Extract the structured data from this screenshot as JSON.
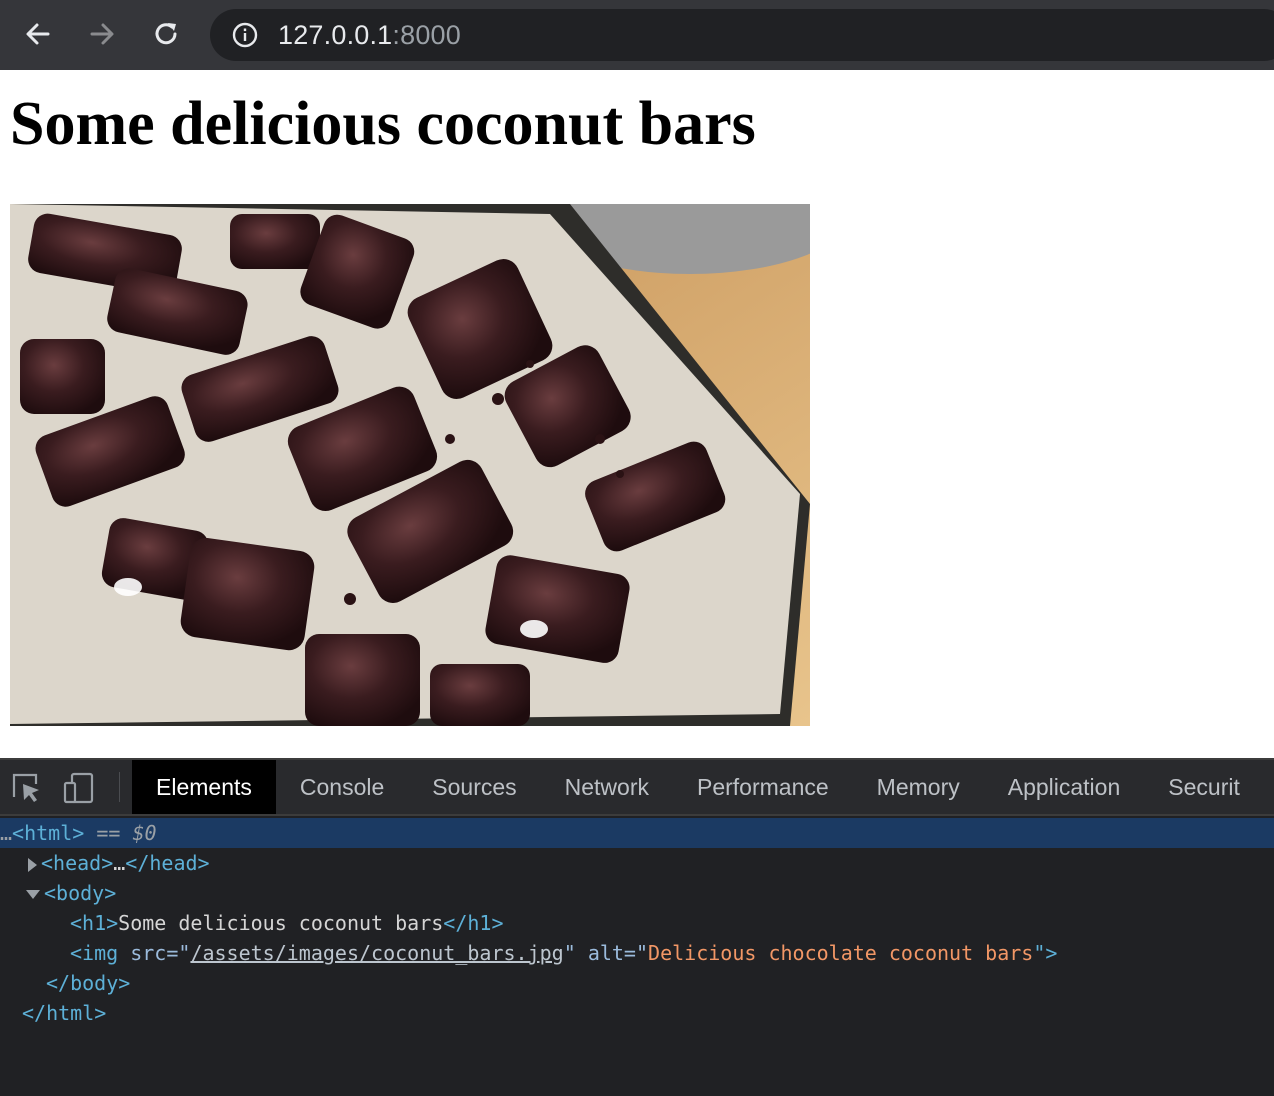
{
  "browser": {
    "url_host": "127.0.0.1",
    "url_port": ":8000",
    "icons": [
      "back-arrow-icon",
      "forward-arrow-icon",
      "reload-icon",
      "info-icon"
    ]
  },
  "page": {
    "title": "Some delicious coconut bars",
    "image_alt": "Delicious chocolate coconut bars"
  },
  "devtools": {
    "tabs": [
      "Elements",
      "Console",
      "Sources",
      "Network",
      "Performance",
      "Memory",
      "Application",
      "Securit"
    ],
    "active_tab": "Elements",
    "dom": {
      "html_open": "<html>",
      "selected_marker": "== ",
      "selected_var": "$0",
      "head_open": "<head>",
      "head_ellipsis": "…",
      "head_close": "</head>",
      "body_open": "<body>",
      "h1_open": "<h1>",
      "h1_text": "Some delicious coconut bars",
      "h1_close": "</h1>",
      "img_open": "<img ",
      "img_src_attr": "src=\"",
      "img_src": "/assets/images/coconut_bars.jpg",
      "img_src_end": "\" ",
      "img_alt_attr": "alt=\"",
      "img_alt": "Delicious chocolate coconut bars",
      "img_close": "\">",
      "body_close": "</body>",
      "html_close": "</html>"
    }
  },
  "colors": {
    "devtools_bg": "#202124",
    "selected_row": "#1b3a63",
    "tag": "#5db0d7",
    "attr_value": "#f29766"
  }
}
